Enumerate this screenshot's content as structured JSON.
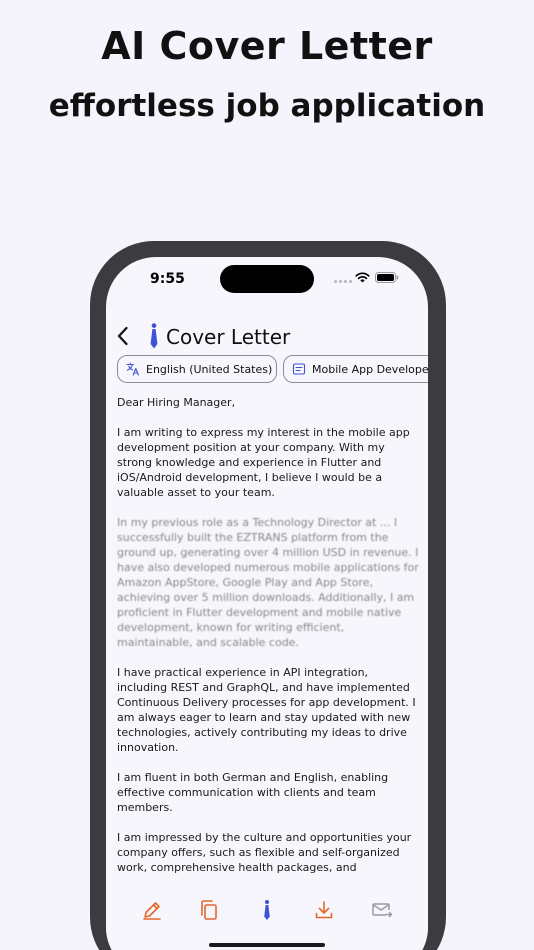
{
  "promo": {
    "title": "AI Cover Letter",
    "subtitle": "effortless job application"
  },
  "status_bar": {
    "time": "9:55"
  },
  "nav": {
    "title": "Cover Letter",
    "back_icon": "chevron-left-icon",
    "brand_icon": "tie-icon"
  },
  "chips": {
    "language": "English (United States)",
    "job": "Mobile App Developer"
  },
  "letter": {
    "greeting": "Dear Hiring Manager,",
    "p1": "I am writing to express my interest in the mobile app development position at your company. With my strong knowledge and experience in Flutter and iOS/Android development, I believe I would be a valuable asset to your team.",
    "p2": "In my previous role as a Technology Director at ... I successfully built the EZTRANS platform from the ground up, generating over 4 million USD in revenue. I have also developed numerous mobile applications for Amazon AppStore, Google Play and App Store, achieving over 5 million downloads. Additionally, I am proficient in Flutter development and mobile native development, known for writing efficient, maintainable, and scalable code.",
    "p3": "I have practical experience in API integration, including REST and GraphQL, and have implemented Continuous Delivery processes for app development. I am always eager to learn and stay updated with new technologies, actively contributing my ideas to drive innovation.",
    "p4": "I am fluent in both German and English, enabling effective communication with clients and team members.",
    "p5": "I am impressed by the culture and opportunities your company offers, such as flexible and self-organized work, comprehensive health packages, and professional development programs. I am excited about the possibility of joining your team and contributing to the success of your company."
  },
  "toolbar": {
    "items": [
      "pencil-icon",
      "copy-icon",
      "tie-icon",
      "download-icon",
      "email-icon"
    ]
  },
  "colors": {
    "accent": "#e4672a",
    "brand_blue": "#3f51d6",
    "muted_icon": "#9a9aa2",
    "phone_frame": "#3c3b40",
    "background": "#f5f4fc"
  }
}
